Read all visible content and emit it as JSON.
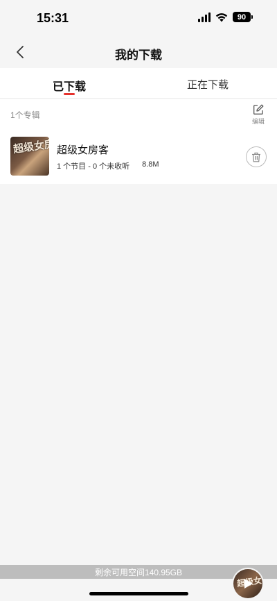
{
  "status_bar": {
    "time": "15:31",
    "battery": "90",
    "icons": [
      "signal-icon",
      "wifi-icon",
      "battery-icon"
    ]
  },
  "nav": {
    "title": "我的下载",
    "back_icon": "chevron-left-icon"
  },
  "tabs": [
    {
      "label": "已下载",
      "active": true
    },
    {
      "label": "正在下载",
      "active": false
    }
  ],
  "downloaded": {
    "album_count": "1个专辑",
    "edit_label": "编辑",
    "albums": [
      {
        "title": "超级女房客",
        "meta": "1 个节目 - 0 个未收听",
        "size": "8.8M",
        "cover_text": "超级女房客"
      }
    ]
  },
  "storage": {
    "text": "剩余可用空间140.95GB"
  },
  "mini_player": {
    "cover_text": "超级女房客",
    "icon": "play-icon"
  },
  "colors": {
    "accent": "#e5322d",
    "background": "#f5f5f5",
    "storage_bar": "#bdbdbd"
  }
}
